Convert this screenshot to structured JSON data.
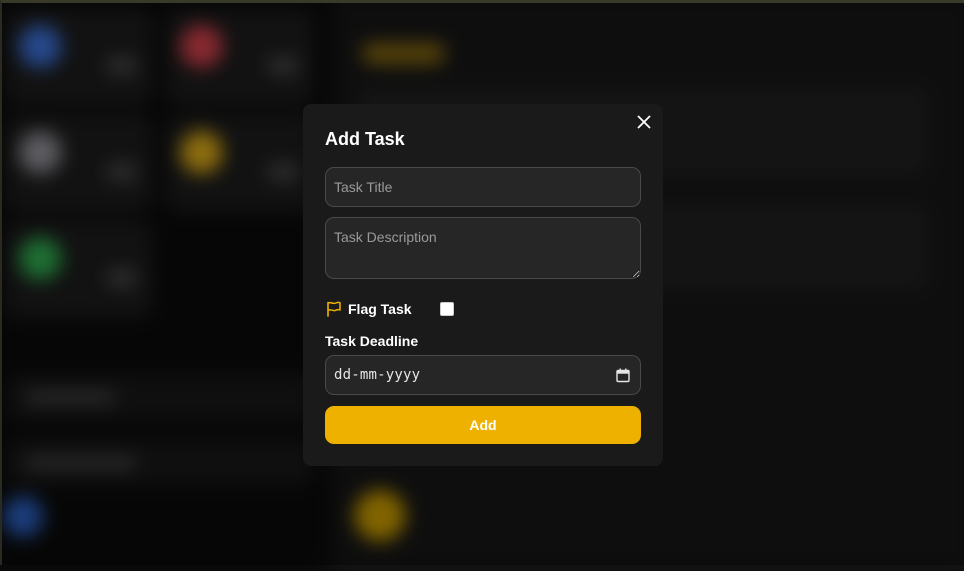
{
  "modal": {
    "title": "Add Task",
    "title_placeholder": "Task Title",
    "description_placeholder": "Task Description",
    "flag_label": "Flag Task",
    "flag_checked": false,
    "deadline_label": "Task Deadline",
    "deadline_value": "dd-mm-yyyy",
    "add_label": "Add"
  },
  "colors": {
    "accent": "#efb100",
    "modal_bg": "#1a1a1a",
    "field_bg": "#262626",
    "field_border": "#4a4a4a"
  },
  "icons": {
    "close": "close-icon",
    "flag": "flag-icon",
    "calendar": "calendar-icon"
  }
}
